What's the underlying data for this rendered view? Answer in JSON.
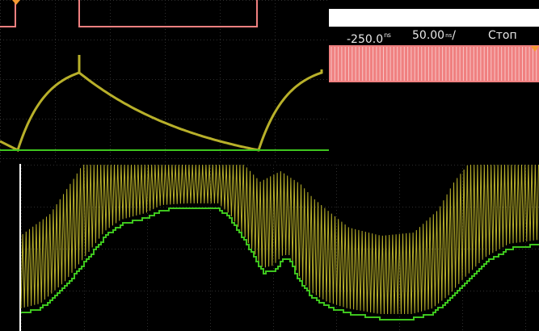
{
  "status": {
    "time_offset_value": "-250.0",
    "time_offset_unit_sup": "ns",
    "timebase_value": "50.00",
    "timebase_unit_top": "ns",
    "timebase_unit_bottom": "/",
    "run_state": "Стоп"
  },
  "colors": {
    "background": "#000000",
    "channel_1": "#b8b02a",
    "channel_2": "#3ec51e",
    "reference_trace": "#f08080",
    "grid": "#2a2a2a",
    "white_panel": "#ffffff",
    "marker": "#f59a30"
  },
  "icons": {
    "top_marker": "trigger-marker-icon",
    "right_marker": "trigger-marker-icon"
  }
}
